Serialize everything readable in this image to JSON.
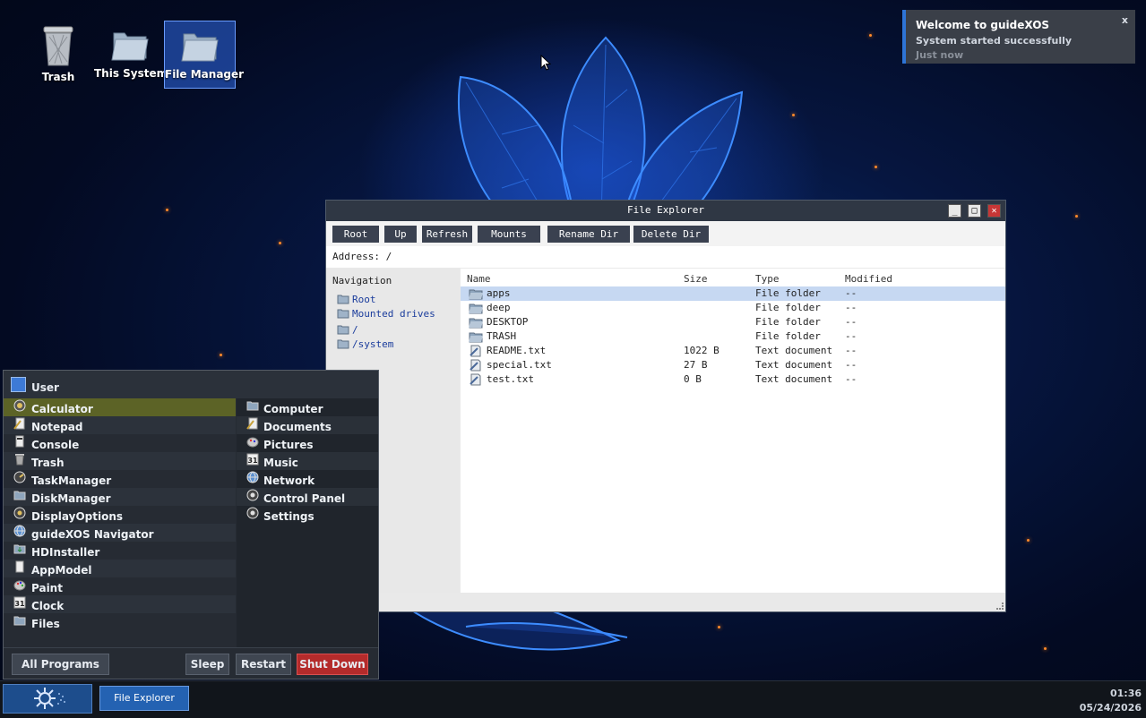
{
  "desktop": {
    "icons": [
      {
        "label": "Trash",
        "icon": "trash-icon"
      },
      {
        "label": "This System",
        "icon": "folder-icon"
      },
      {
        "label": "File Manager",
        "icon": "folder-icon",
        "selected": true
      }
    ]
  },
  "notification": {
    "title": "Welcome to guideXOS",
    "message": "System started successfully",
    "time": "Just now",
    "close": "x"
  },
  "explorer": {
    "title": "File Explorer",
    "controls": {
      "minimize": "_",
      "maximize": "□",
      "close": "✕"
    },
    "toolbar": [
      "Root",
      "Up",
      "Refresh",
      "Mounts",
      "Rename Dir",
      "Delete Dir"
    ],
    "address": "Address: /",
    "nav": {
      "header": "Navigation",
      "items": [
        "Root",
        "Mounted drives",
        "/",
        "/system"
      ]
    },
    "columns": [
      "Name",
      "Size",
      "Type",
      "Modified"
    ],
    "files": [
      {
        "name": "apps",
        "size": "",
        "type": "File folder",
        "modified": "--",
        "kind": "folder",
        "selected": true
      },
      {
        "name": "deep",
        "size": "",
        "type": "File folder",
        "modified": "--",
        "kind": "folder"
      },
      {
        "name": "DESKTOP",
        "size": "",
        "type": "File folder",
        "modified": "--",
        "kind": "folder"
      },
      {
        "name": "TRASH",
        "size": "",
        "type": "File folder",
        "modified": "--",
        "kind": "folder"
      },
      {
        "name": "README.txt",
        "size": "1022 B",
        "type": "Text document",
        "modified": "--",
        "kind": "text"
      },
      {
        "name": "special.txt",
        "size": "27 B",
        "type": "Text document",
        "modified": "--",
        "kind": "text"
      },
      {
        "name": "test.txt",
        "size": "0 B",
        "type": "Text document",
        "modified": "--",
        "kind": "text"
      }
    ]
  },
  "start_menu": {
    "user": "User",
    "programs": [
      {
        "label": "Calculator",
        "icon": "calculator-icon",
        "active": true
      },
      {
        "label": "Notepad",
        "icon": "notepad-icon"
      },
      {
        "label": "Console",
        "icon": "console-icon"
      },
      {
        "label": "Trash",
        "icon": "trash-icon"
      },
      {
        "label": "TaskManager",
        "icon": "gauge-icon"
      },
      {
        "label": "DiskManager",
        "icon": "disk-icon"
      },
      {
        "label": "DisplayOptions",
        "icon": "display-icon"
      },
      {
        "label": "guideXOS Navigator",
        "icon": "globe-icon"
      },
      {
        "label": "HDInstaller",
        "icon": "installer-icon"
      },
      {
        "label": "AppModel",
        "icon": "document-icon"
      },
      {
        "label": "Paint",
        "icon": "paint-icon"
      },
      {
        "label": "Clock",
        "icon": "clock-icon"
      },
      {
        "label": "Files",
        "icon": "folder-icon"
      }
    ],
    "places": [
      {
        "label": "Computer",
        "icon": "computer-icon"
      },
      {
        "label": "Documents",
        "icon": "documents-icon"
      },
      {
        "label": "Pictures",
        "icon": "pictures-icon"
      },
      {
        "label": "Music",
        "icon": "music-icon"
      },
      {
        "label": "Network",
        "icon": "network-icon"
      },
      {
        "label": "Control Panel",
        "icon": "control-panel-icon"
      },
      {
        "label": "Settings",
        "icon": "settings-icon"
      }
    ],
    "buttons": {
      "all_programs": "All Programs",
      "sleep": "Sleep",
      "restart": "Restart",
      "shutdown": "Shut Down"
    }
  },
  "taskbar": {
    "tasks": [
      "File Explorer"
    ],
    "time": "01:36",
    "date": "05/24/2026"
  },
  "colors": {
    "accent": "#2462b2",
    "danger": "#b42b2b",
    "active_menu": "#5c6326",
    "selection": "#c6d8f2"
  }
}
